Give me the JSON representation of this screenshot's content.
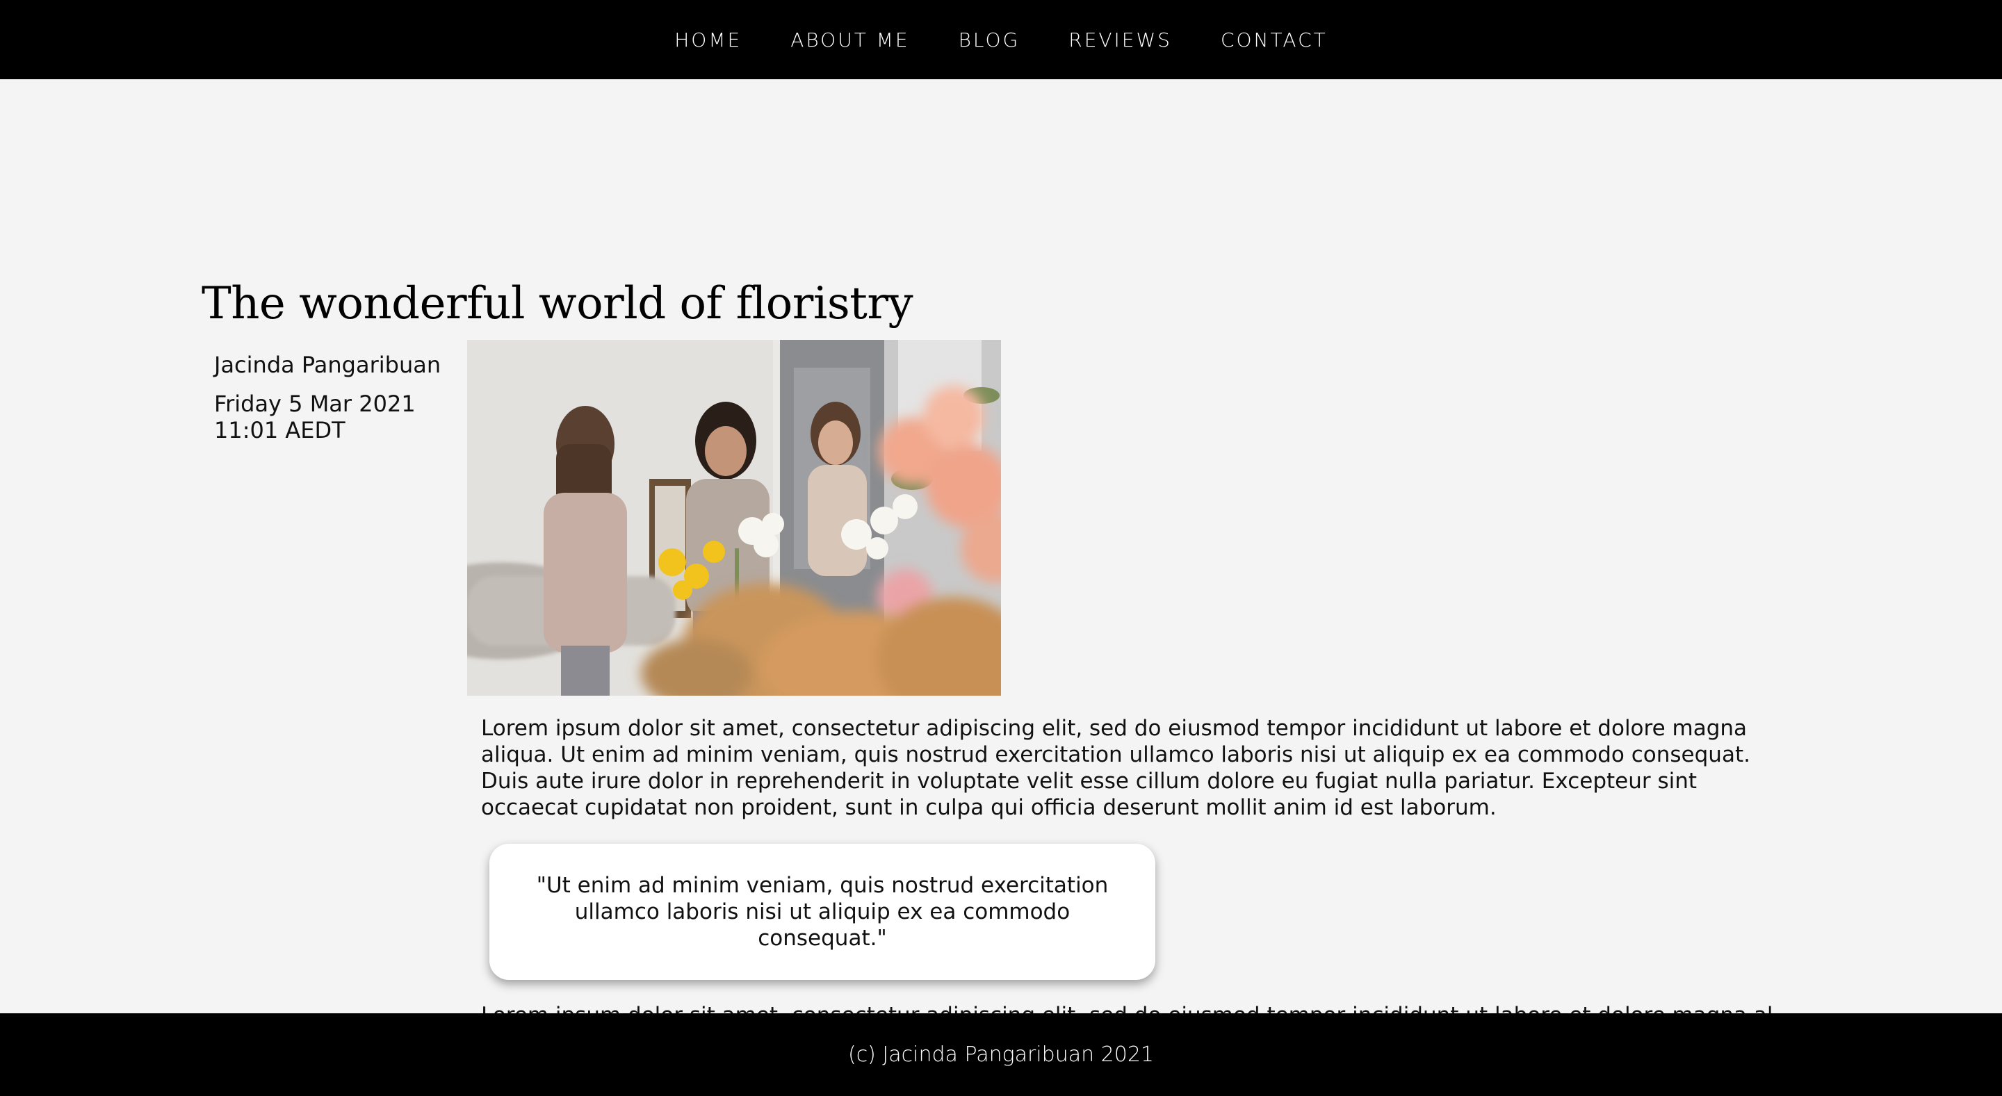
{
  "nav": {
    "items": [
      {
        "label": "HOME"
      },
      {
        "label": "ABOUT ME"
      },
      {
        "label": "BLOG"
      },
      {
        "label": "REVIEWS"
      },
      {
        "label": "CONTACT"
      }
    ]
  },
  "post": {
    "title": "The wonderful world of floristry",
    "author": "Jacinda Pangaribuan",
    "date": "Friday 5 Mar 2021 11:01 AEDT",
    "image_icon": "photo-florists-arranging-flowers",
    "paragraphs": [
      "Lorem ipsum dolor sit amet, consectetur adipiscing elit, sed do eiusmod tempor incididunt ut labore et dolore magna aliqua. Ut enim ad minim veniam, quis nostrud exercitation ullamco laboris nisi ut aliquip ex ea commodo consequat. Duis aute irure dolor in reprehenderit in voluptate velit esse cillum dolore eu fugiat nulla pariatur. Excepteur sint occaecat cupidatat non proident, sunt in culpa qui officia deserunt mollit anim id est laborum.",
      "Lorem ipsum dolor sit amet, consectetur adipiscing elit, sed do eiusmod tempor incididunt ut labore et dolore magna aliqua."
    ],
    "quote": "\"Ut enim ad minim veniam, quis nostrud exercitation ullamco laboris nisi ut aliquip ex ea commodo consequat.\""
  },
  "footer": {
    "text": "(c) Jacinda Pangaribuan 2021"
  },
  "colors": {
    "nav_bg": "#000000",
    "page_bg": "#f4f4f4",
    "card_bg": "#ffffff"
  }
}
